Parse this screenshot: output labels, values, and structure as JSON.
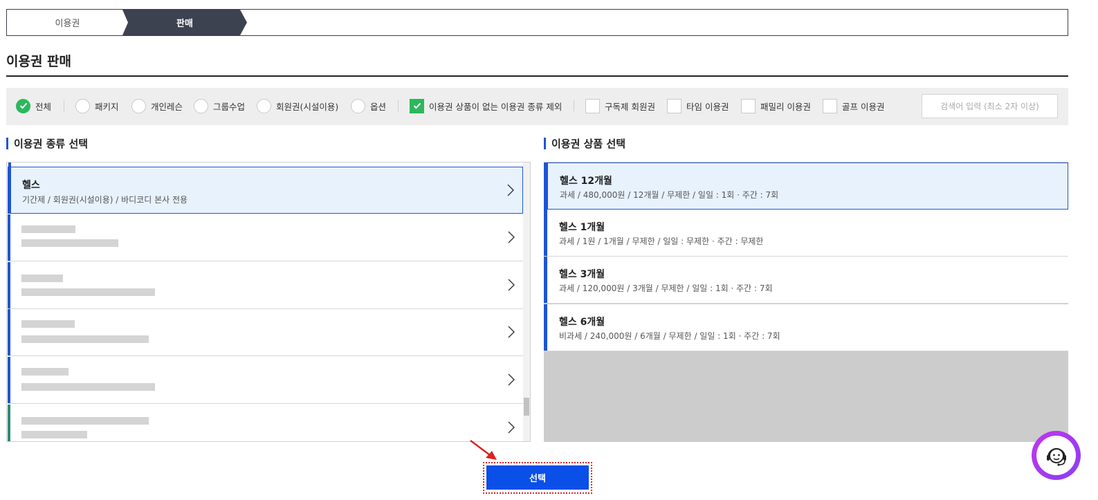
{
  "breadcrumb": {
    "step1": "이용권",
    "step2": "판매"
  },
  "page_title": "이용권 판매",
  "filters": {
    "radios": [
      {
        "label": "전체",
        "checked": true
      },
      {
        "label": "패키지",
        "checked": false
      },
      {
        "label": "개인레슨",
        "checked": false
      },
      {
        "label": "그룹수업",
        "checked": false
      },
      {
        "label": "회원권(시설이용)",
        "checked": false
      },
      {
        "label": "옵션",
        "checked": false
      }
    ],
    "checkboxes": [
      {
        "label": "이용권 상품이 없는 이용권 종류 제외",
        "checked": true
      },
      {
        "label": "구독제 회원권",
        "checked": false
      },
      {
        "label": "타임 이용권",
        "checked": false
      },
      {
        "label": "패밀리 이용권",
        "checked": false
      },
      {
        "label": "골프 이용권",
        "checked": false
      }
    ],
    "search_placeholder": "검색어 입력 (최소 2자 이상)"
  },
  "sections": {
    "type_title": "이용권 종류 선택",
    "product_title": "이용권 상품 선택"
  },
  "types": [
    {
      "name": "헬스",
      "desc": "기간제 / 회원권(시설이용) / 바디코디 본사 전용",
      "selected": true
    }
  ],
  "products": [
    {
      "name": "헬스 12개월",
      "desc": "과세 / 480,000원 / 12개월 / 무제한 / 일일 : 1회 · 주간 : 7회",
      "selected": true
    },
    {
      "name": "헬스 1개월",
      "desc": "과세 / 1원 / 1개월 / 무제한 / 일일 : 무제한 · 주간 : 무제한",
      "selected": false
    },
    {
      "name": "헬스 3개월",
      "desc": "과세 / 120,000원 / 3개월 / 무제한 / 일일 : 1회 · 주간 : 7회",
      "selected": false
    },
    {
      "name": "헬스 6개월",
      "desc": "비과세 / 240,000원 / 6개월 / 무제한 / 일일 : 1회 · 주간 : 7회",
      "selected": false
    }
  ],
  "select_button": "선택",
  "colors": {
    "accent": "#1e55d6",
    "check_green": "#2db75d",
    "button_blue": "#0a4fe8",
    "selected_bg": "#e7f2fc",
    "annotation_red": "#e02020",
    "help_purple": "#b03cf0"
  }
}
